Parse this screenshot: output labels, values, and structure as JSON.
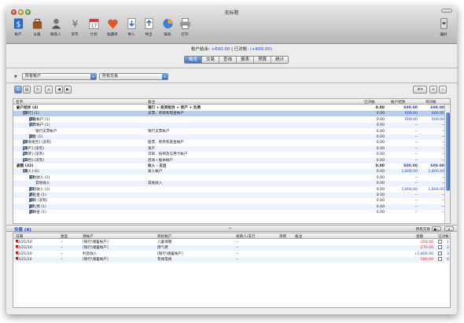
{
  "window": {
    "title": "无标题"
  },
  "toolbar": {
    "buttons": [
      {
        "label": "帐户",
        "icon": "account-icon"
      },
      {
        "label": "分类",
        "icon": "category-icon"
      },
      {
        "label": "联系人",
        "icon": "contact-icon"
      },
      {
        "label": "货币",
        "icon": "currency-icon"
      },
      {
        "label": "计划",
        "icon": "schedule-icon"
      },
      {
        "label": "收藏夹",
        "icon": "favorites-icon"
      },
      {
        "label": "导入",
        "icon": "import-icon"
      },
      {
        "label": "导出",
        "icon": "export-icon"
      },
      {
        "label": "报表",
        "icon": "report-icon"
      },
      {
        "label": "打印",
        "icon": "print-icon"
      },
      {
        "label": "偏好",
        "icon": "preferences-icon"
      }
    ]
  },
  "summary": {
    "balance_label": "帐户结余:",
    "balance_value": "+600.00",
    "reconciled_label": "已对帐:",
    "reconciled_value": "(+600.00)"
  },
  "tabs": [
    "概览",
    "交易",
    "查询",
    "报表",
    "预算",
    "统计"
  ],
  "filters": {
    "account": "所有帐户",
    "transaction": "所有交易"
  },
  "outline": {
    "columns": {
      "name": "名字",
      "note": "备注",
      "reconciled": "已对帐",
      "balance": "帐户结余",
      "pending": "待对帐"
    },
    "rows": [
      {
        "name": "帐户结余 (4)",
        "note": "银行 + 投资组合 + 资产 + 负债",
        "reconciled": "0.00",
        "balance": "600.00",
        "pending": "600.00",
        "level": 0,
        "bold": true,
        "triangle": "▼",
        "folder": false,
        "style": ""
      },
      {
        "name": "[银行] (1)",
        "note": "支票、存款和现金帐户",
        "reconciled": "0.00",
        "balance": "600.00",
        "pending": "600.00",
        "level": 1,
        "bold": false,
        "triangle": "▼",
        "folder": true,
        "style": "sel"
      },
      {
        "name": "储蓄帐户 (1)",
        "note": "",
        "reconciled": "0.00",
        "balance": "600.00",
        "pending": "600.00",
        "level": 2,
        "bold": false,
        "triangle": "▶",
        "folder": true,
        "style": ""
      },
      {
        "name": "支票帐户 (1)",
        "note": "",
        "reconciled": "0.00",
        "balance": "--",
        "pending": "--",
        "level": 2,
        "bold": false,
        "triangle": "▼",
        "folder": true,
        "style": "alt"
      },
      {
        "name": "银行支票帐户",
        "note": "银行支票帐户",
        "reconciled": "0.00",
        "balance": "--",
        "pending": "--",
        "level": 3,
        "bold": false,
        "triangle": "",
        "folder": false,
        "style": ""
      },
      {
        "name": "现金 (1)",
        "note": "",
        "reconciled": "0.00",
        "balance": "--",
        "pending": "--",
        "level": 2,
        "bold": false,
        "triangle": "▶",
        "folder": true,
        "style": "alt"
      },
      {
        "name": "[投资组合] (没有)",
        "note": "股票、债券和基金帐户",
        "reconciled": "0.00",
        "balance": "--",
        "pending": "--",
        "level": 1,
        "bold": false,
        "triangle": "▶",
        "folder": true,
        "style": ""
      },
      {
        "name": "[资产] (没有)",
        "note": "资产",
        "reconciled": "0.00",
        "balance": "--",
        "pending": "--",
        "level": 1,
        "bold": false,
        "triangle": "▶",
        "folder": true,
        "style": "alt"
      },
      {
        "name": "[负债] (没有)",
        "note": "贷款、按揭及信用卡帐户",
        "reconciled": "0.00",
        "balance": "--",
        "pending": "--",
        "level": 1,
        "bold": false,
        "triangle": "▶",
        "folder": true,
        "style": ""
      },
      {
        "name": "[归档] (没有)",
        "note": "启动 / 股本帐户",
        "reconciled": "0.00",
        "balance": "--",
        "pending": "--",
        "level": 1,
        "bold": false,
        "triangle": "▶",
        "folder": true,
        "style": "alt"
      },
      {
        "name": "视图 (32)",
        "note": "收入 - 支出",
        "reconciled": "0.00",
        "balance": "600.00",
        "pending": "600.00",
        "level": 0,
        "bold": true,
        "triangle": "▼",
        "folder": false,
        "style": ""
      },
      {
        "name": "[收入] (6)",
        "note": "收入帐户",
        "reconciled": "0.00",
        "balance": "1,800.00",
        "pending": "1,800.00",
        "level": 1,
        "bold": false,
        "triangle": "▼",
        "folder": true,
        "style": "alt"
      },
      {
        "name": "其他收入 (1)",
        "note": "",
        "reconciled": "0.00",
        "balance": "--",
        "pending": "--",
        "level": 2,
        "bold": false,
        "triangle": "▼",
        "folder": true,
        "style": ""
      },
      {
        "name": "其他收入",
        "note": "其他收入",
        "reconciled": "0.00",
        "balance": "--",
        "pending": "--",
        "level": 3,
        "bold": false,
        "triangle": "",
        "folder": false,
        "style": "alt"
      },
      {
        "name": "利息收入 (1)",
        "note": "",
        "reconciled": "0.00",
        "balance": "1,800.00",
        "pending": "1,800.00",
        "level": 2,
        "bold": false,
        "triangle": "▶",
        "folder": true,
        "style": ""
      },
      {
        "name": "失业金 (1)",
        "note": "",
        "reconciled": "0.00",
        "balance": "--",
        "pending": "--",
        "level": 2,
        "bold": false,
        "triangle": "▶",
        "folder": true,
        "style": "alt"
      },
      {
        "name": "投资 (没有)",
        "note": "",
        "reconciled": "0.00",
        "balance": "--",
        "pending": "--",
        "level": 2,
        "bold": false,
        "triangle": "▶",
        "folder": true,
        "style": ""
      },
      {
        "name": "收礼物 (1)",
        "note": "",
        "reconciled": "0.00",
        "balance": "--",
        "pending": "--",
        "level": 2,
        "bold": false,
        "triangle": "▶",
        "folder": true,
        "style": "alt"
      },
      {
        "name": "退休金 (1)",
        "note": "",
        "reconciled": "0.00",
        "balance": "--",
        "pending": "--",
        "level": 2,
        "bold": false,
        "triangle": "▶",
        "folder": true,
        "style": ""
      }
    ]
  },
  "transactions": {
    "title": "交易 (4)",
    "filter_label": "所有交易",
    "columns": {
      "date": "日期",
      "type": "类型",
      "source": "源帐户",
      "target": "目标帐户",
      "payee": "收款人/支行",
      "item": "项目",
      "note": "备注",
      "amount": "金额",
      "reconciled": "已对帐"
    },
    "rows": [
      {
        "date": "12/21/10",
        "type": "--",
        "source": "[银行\\储蓄帐户]",
        "target": "儿童保健",
        "payee": "--",
        "amount": "-350.00",
        "num": "1"
      },
      {
        "date": "12/21/10",
        "type": "--",
        "source": "[银行\\储蓄帐户]",
        "target": "燃气费",
        "payee": "--",
        "amount": "-270.00",
        "num": "2"
      },
      {
        "date": "12/21/10",
        "type": "--",
        "source": "利息收入",
        "target": "[银行\\储蓄帐户]",
        "payee": "--",
        "amount": "+1,800.00",
        "num": "3"
      },
      {
        "date": "12/21/10",
        "type": "--",
        "source": "[银行\\储蓄帐户]",
        "target": "有线电视",
        "payee": "--",
        "amount": "-580.00",
        "num": "4"
      }
    ]
  }
}
